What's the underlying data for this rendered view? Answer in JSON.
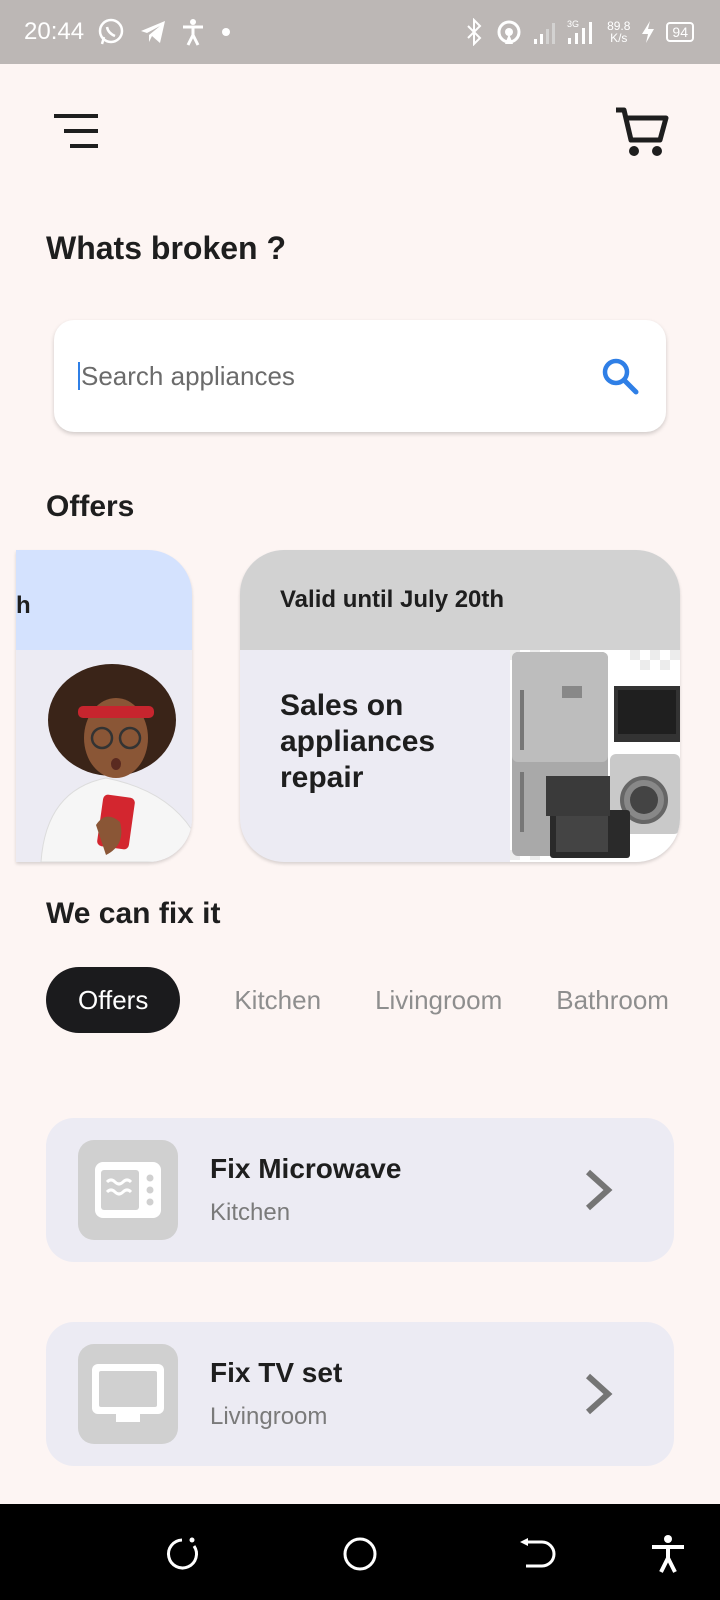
{
  "status_bar": {
    "time": "20:44",
    "net_speed_value": "89.8",
    "net_speed_unit": "K/s",
    "battery": "94",
    "network_label": "3G"
  },
  "header": {
    "menu_icon": "menu-icon",
    "cart_icon": "cart-icon"
  },
  "page_title": "Whats broken ?",
  "search": {
    "placeholder": "Search appliances",
    "icon": "search-icon",
    "accent_color": "#2F7FE6"
  },
  "offers": {
    "title": "Offers",
    "cards": [
      {
        "header": "h",
        "image": "surprised-woman-with-phone"
      },
      {
        "header": "Valid until July 20th",
        "body": "Sales on appliances repair",
        "image": "home-appliances"
      }
    ]
  },
  "fix_section": {
    "title": "We can fix it",
    "tabs": [
      {
        "label": "Offers",
        "active": true
      },
      {
        "label": "Kitchen",
        "active": false
      },
      {
        "label": "Livingroom",
        "active": false
      },
      {
        "label": "Bathroom",
        "active": false
      }
    ]
  },
  "services": [
    {
      "name": "Fix Microwave",
      "category": "Kitchen",
      "icon": "microwave-icon"
    },
    {
      "name": "Fix TV set",
      "category": "Livingroom",
      "icon": "tv-icon"
    }
  ],
  "nav_bar": {
    "buttons": [
      "recents-icon",
      "home-icon",
      "back-icon",
      "accessibility-icon"
    ]
  },
  "colors": {
    "background": "#FDF5F3",
    "active_chip": "#1B1B1D",
    "card": "#ECEBF3",
    "status_bar": "#BCB7B5"
  }
}
